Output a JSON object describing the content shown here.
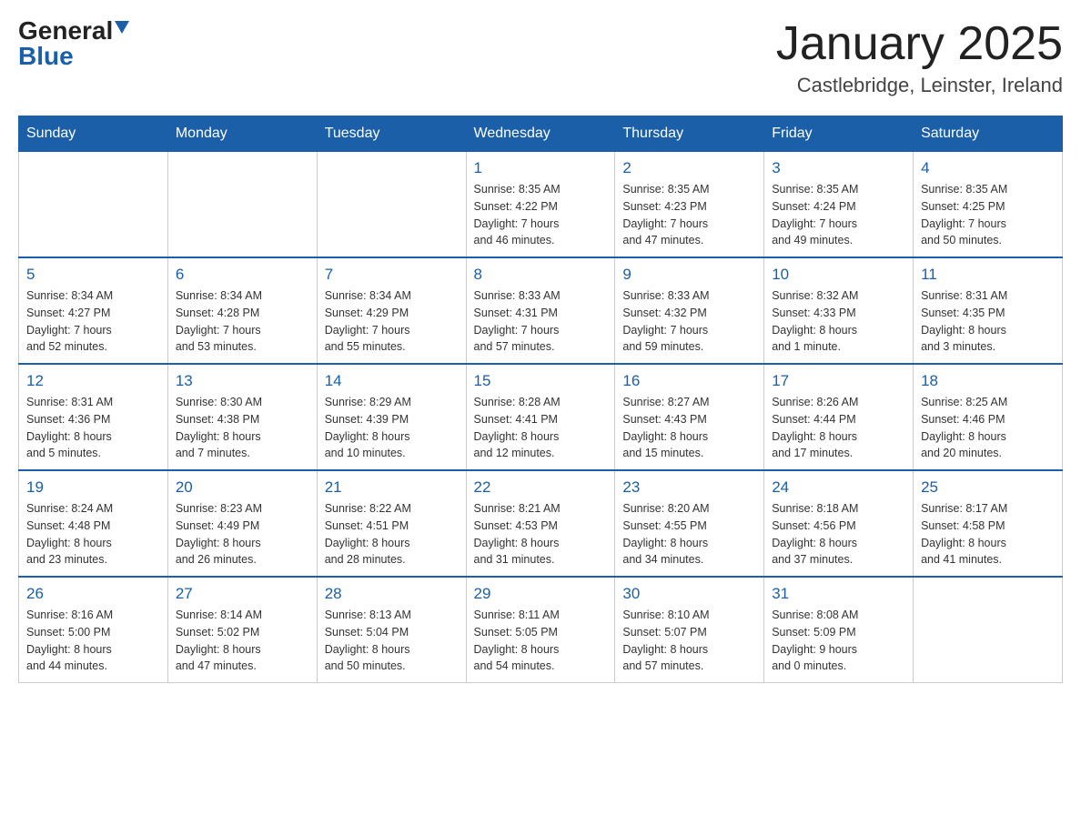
{
  "header": {
    "logo_general": "General",
    "logo_blue": "Blue",
    "title": "January 2025",
    "subtitle": "Castlebridge, Leinster, Ireland"
  },
  "days_of_week": [
    "Sunday",
    "Monday",
    "Tuesday",
    "Wednesday",
    "Thursday",
    "Friday",
    "Saturday"
  ],
  "weeks": [
    [
      {
        "day": "",
        "info": ""
      },
      {
        "day": "",
        "info": ""
      },
      {
        "day": "",
        "info": ""
      },
      {
        "day": "1",
        "info": "Sunrise: 8:35 AM\nSunset: 4:22 PM\nDaylight: 7 hours\nand 46 minutes."
      },
      {
        "day": "2",
        "info": "Sunrise: 8:35 AM\nSunset: 4:23 PM\nDaylight: 7 hours\nand 47 minutes."
      },
      {
        "day": "3",
        "info": "Sunrise: 8:35 AM\nSunset: 4:24 PM\nDaylight: 7 hours\nand 49 minutes."
      },
      {
        "day": "4",
        "info": "Sunrise: 8:35 AM\nSunset: 4:25 PM\nDaylight: 7 hours\nand 50 minutes."
      }
    ],
    [
      {
        "day": "5",
        "info": "Sunrise: 8:34 AM\nSunset: 4:27 PM\nDaylight: 7 hours\nand 52 minutes."
      },
      {
        "day": "6",
        "info": "Sunrise: 8:34 AM\nSunset: 4:28 PM\nDaylight: 7 hours\nand 53 minutes."
      },
      {
        "day": "7",
        "info": "Sunrise: 8:34 AM\nSunset: 4:29 PM\nDaylight: 7 hours\nand 55 minutes."
      },
      {
        "day": "8",
        "info": "Sunrise: 8:33 AM\nSunset: 4:31 PM\nDaylight: 7 hours\nand 57 minutes."
      },
      {
        "day": "9",
        "info": "Sunrise: 8:33 AM\nSunset: 4:32 PM\nDaylight: 7 hours\nand 59 minutes."
      },
      {
        "day": "10",
        "info": "Sunrise: 8:32 AM\nSunset: 4:33 PM\nDaylight: 8 hours\nand 1 minute."
      },
      {
        "day": "11",
        "info": "Sunrise: 8:31 AM\nSunset: 4:35 PM\nDaylight: 8 hours\nand 3 minutes."
      }
    ],
    [
      {
        "day": "12",
        "info": "Sunrise: 8:31 AM\nSunset: 4:36 PM\nDaylight: 8 hours\nand 5 minutes."
      },
      {
        "day": "13",
        "info": "Sunrise: 8:30 AM\nSunset: 4:38 PM\nDaylight: 8 hours\nand 7 minutes."
      },
      {
        "day": "14",
        "info": "Sunrise: 8:29 AM\nSunset: 4:39 PM\nDaylight: 8 hours\nand 10 minutes."
      },
      {
        "day": "15",
        "info": "Sunrise: 8:28 AM\nSunset: 4:41 PM\nDaylight: 8 hours\nand 12 minutes."
      },
      {
        "day": "16",
        "info": "Sunrise: 8:27 AM\nSunset: 4:43 PM\nDaylight: 8 hours\nand 15 minutes."
      },
      {
        "day": "17",
        "info": "Sunrise: 8:26 AM\nSunset: 4:44 PM\nDaylight: 8 hours\nand 17 minutes."
      },
      {
        "day": "18",
        "info": "Sunrise: 8:25 AM\nSunset: 4:46 PM\nDaylight: 8 hours\nand 20 minutes."
      }
    ],
    [
      {
        "day": "19",
        "info": "Sunrise: 8:24 AM\nSunset: 4:48 PM\nDaylight: 8 hours\nand 23 minutes."
      },
      {
        "day": "20",
        "info": "Sunrise: 8:23 AM\nSunset: 4:49 PM\nDaylight: 8 hours\nand 26 minutes."
      },
      {
        "day": "21",
        "info": "Sunrise: 8:22 AM\nSunset: 4:51 PM\nDaylight: 8 hours\nand 28 minutes."
      },
      {
        "day": "22",
        "info": "Sunrise: 8:21 AM\nSunset: 4:53 PM\nDaylight: 8 hours\nand 31 minutes."
      },
      {
        "day": "23",
        "info": "Sunrise: 8:20 AM\nSunset: 4:55 PM\nDaylight: 8 hours\nand 34 minutes."
      },
      {
        "day": "24",
        "info": "Sunrise: 8:18 AM\nSunset: 4:56 PM\nDaylight: 8 hours\nand 37 minutes."
      },
      {
        "day": "25",
        "info": "Sunrise: 8:17 AM\nSunset: 4:58 PM\nDaylight: 8 hours\nand 41 minutes."
      }
    ],
    [
      {
        "day": "26",
        "info": "Sunrise: 8:16 AM\nSunset: 5:00 PM\nDaylight: 8 hours\nand 44 minutes."
      },
      {
        "day": "27",
        "info": "Sunrise: 8:14 AM\nSunset: 5:02 PM\nDaylight: 8 hours\nand 47 minutes."
      },
      {
        "day": "28",
        "info": "Sunrise: 8:13 AM\nSunset: 5:04 PM\nDaylight: 8 hours\nand 50 minutes."
      },
      {
        "day": "29",
        "info": "Sunrise: 8:11 AM\nSunset: 5:05 PM\nDaylight: 8 hours\nand 54 minutes."
      },
      {
        "day": "30",
        "info": "Sunrise: 8:10 AM\nSunset: 5:07 PM\nDaylight: 8 hours\nand 57 minutes."
      },
      {
        "day": "31",
        "info": "Sunrise: 8:08 AM\nSunset: 5:09 PM\nDaylight: 9 hours\nand 0 minutes."
      },
      {
        "day": "",
        "info": ""
      }
    ]
  ]
}
